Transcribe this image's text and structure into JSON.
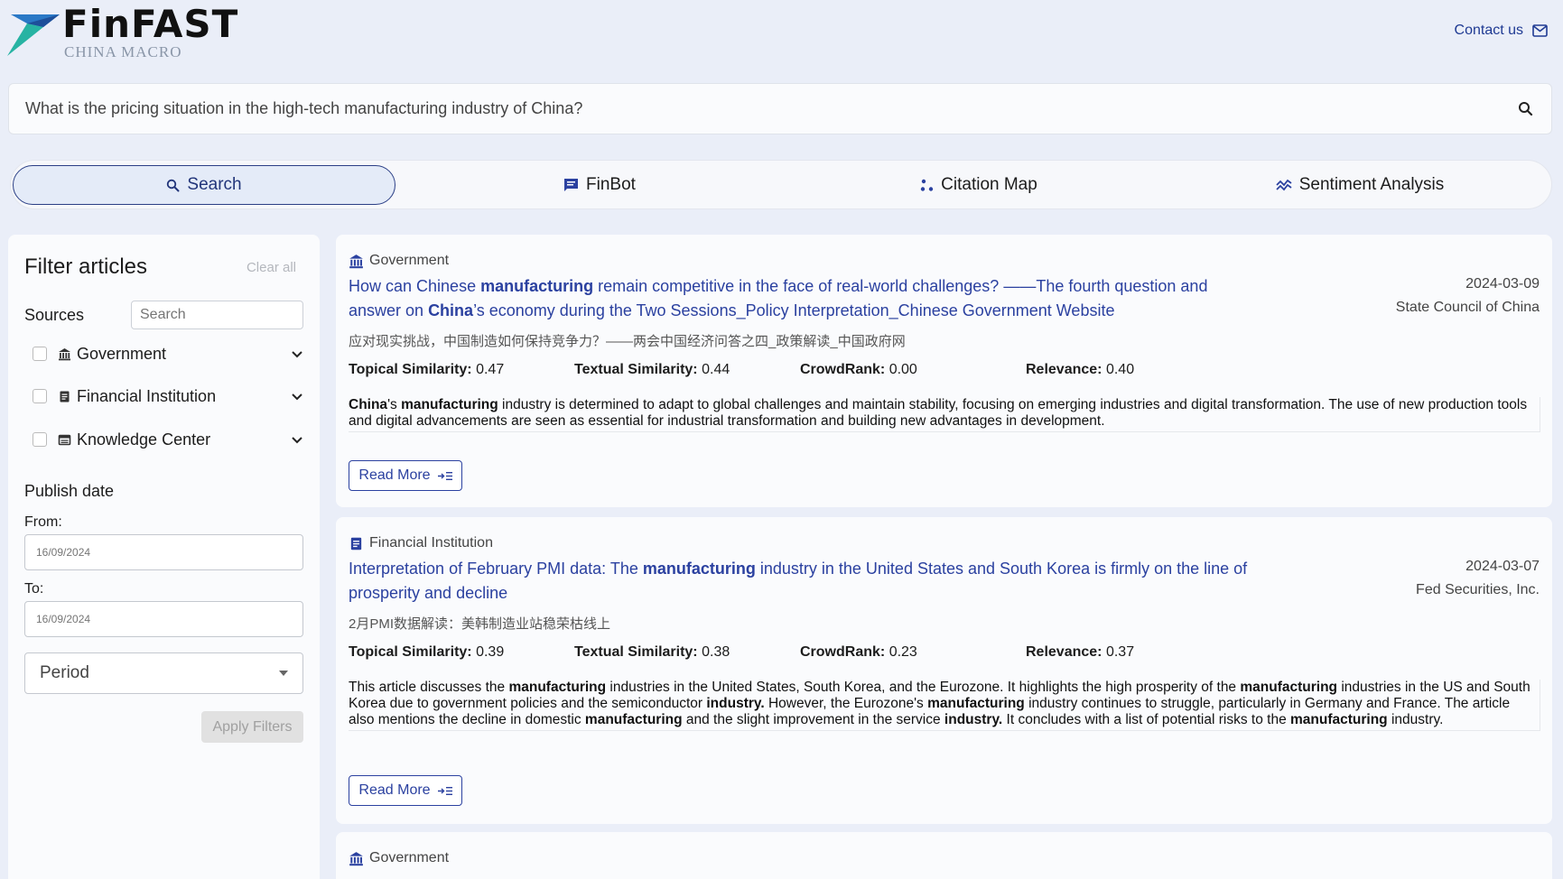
{
  "brand": {
    "name": "FinFAST",
    "subtitle": "CHINA MACRO",
    "accent": "#1f3a93"
  },
  "header": {
    "contact_label": "Contact us"
  },
  "search": {
    "query": "What is the pricing situation in the high-tech manufacturing industry of China?"
  },
  "tabs": [
    {
      "label": "Search",
      "icon": "search-icon",
      "active": true
    },
    {
      "label": "FinBot",
      "icon": "chat-icon",
      "active": false
    },
    {
      "label": "Citation Map",
      "icon": "citation-map-icon",
      "active": false
    },
    {
      "label": "Sentiment Analysis",
      "icon": "sentiment-icon",
      "active": false
    }
  ],
  "filters": {
    "title": "Filter articles",
    "clear_label": "Clear all",
    "sources_label": "Sources",
    "sources_search_placeholder": "Search",
    "sources": [
      {
        "label": "Government",
        "icon": "government-icon"
      },
      {
        "label": "Financial Institution",
        "icon": "document-icon"
      },
      {
        "label": "Knowledge Center",
        "icon": "library-icon"
      }
    ],
    "publish_date_label": "Publish date",
    "from_label": "From:",
    "to_label": "To:",
    "date_placeholder": "16/09/2024",
    "period_label": "Period",
    "apply_label": "Apply Filters"
  },
  "articles": [
    {
      "source_type": "Government",
      "title_parts": [
        "How can Chinese ",
        "manufacturing",
        " remain competitive in the face of real-world challenges? ——The fourth question and answer on ",
        "China",
        "’s economy during the Two Sessions_Policy Interpretation_Chinese Government Website"
      ],
      "date": "2024-03-09",
      "publisher": "State Council of China",
      "chinese_title": "应对现实挑战，中国制造如何保持竞争力？——两会中国经济问答之四_政策解读_中国政府网",
      "metrics": [
        {
          "label": "Topical Similarity:",
          "value": "0.47"
        },
        {
          "label": "Textual Similarity:",
          "value": "0.44"
        },
        {
          "label": "CrowdRank:",
          "value": "0.00"
        },
        {
          "label": "Relevance:",
          "value": "0.40"
        }
      ],
      "summary_parts": [
        "China",
        "'s ",
        "manufacturing",
        " industry is determined to adapt to global challenges and maintain stability, focusing on emerging industries and digital transformation. The use of new production tools and digital advancements are seen as essential for industrial transformation and building new advantages in development."
      ],
      "read_more_label": "Read More"
    },
    {
      "source_type": "Financial Institution",
      "title_parts": [
        "Interpretation of February PMI data: The ",
        "manufacturing",
        " industry in the United States and South Korea is firmly on the line of prosperity and decline"
      ],
      "date": "2024-03-07",
      "publisher": "Fed Securities, Inc.",
      "chinese_title": "2月PMI数据解读：美韩制造业站稳荣枯线上",
      "metrics": [
        {
          "label": "Topical Similarity:",
          "value": "0.39"
        },
        {
          "label": "Textual Similarity:",
          "value": "0.38"
        },
        {
          "label": "CrowdRank:",
          "value": "0.23"
        },
        {
          "label": "Relevance:",
          "value": "0.37"
        }
      ],
      "summary_parts": [
        "This article discusses the ",
        "manufacturing",
        " industries in the United States, South Korea, and the Eurozone. It highlights the high prosperity of the ",
        "manufacturing",
        " industries in the US and South Korea due to government policies and the semiconductor ",
        "industry.",
        " However, the Eurozone's ",
        "manufacturing",
        " industry continues to struggle, particularly in Germany and France. The article also mentions the decline in domestic ",
        "manufacturing",
        " and the slight improvement in the service ",
        "industry.",
        " It concludes with a list of potential risks to the ",
        "manufacturing",
        " industry."
      ],
      "read_more_label": "Read More"
    },
    {
      "source_type": "Government"
    }
  ]
}
